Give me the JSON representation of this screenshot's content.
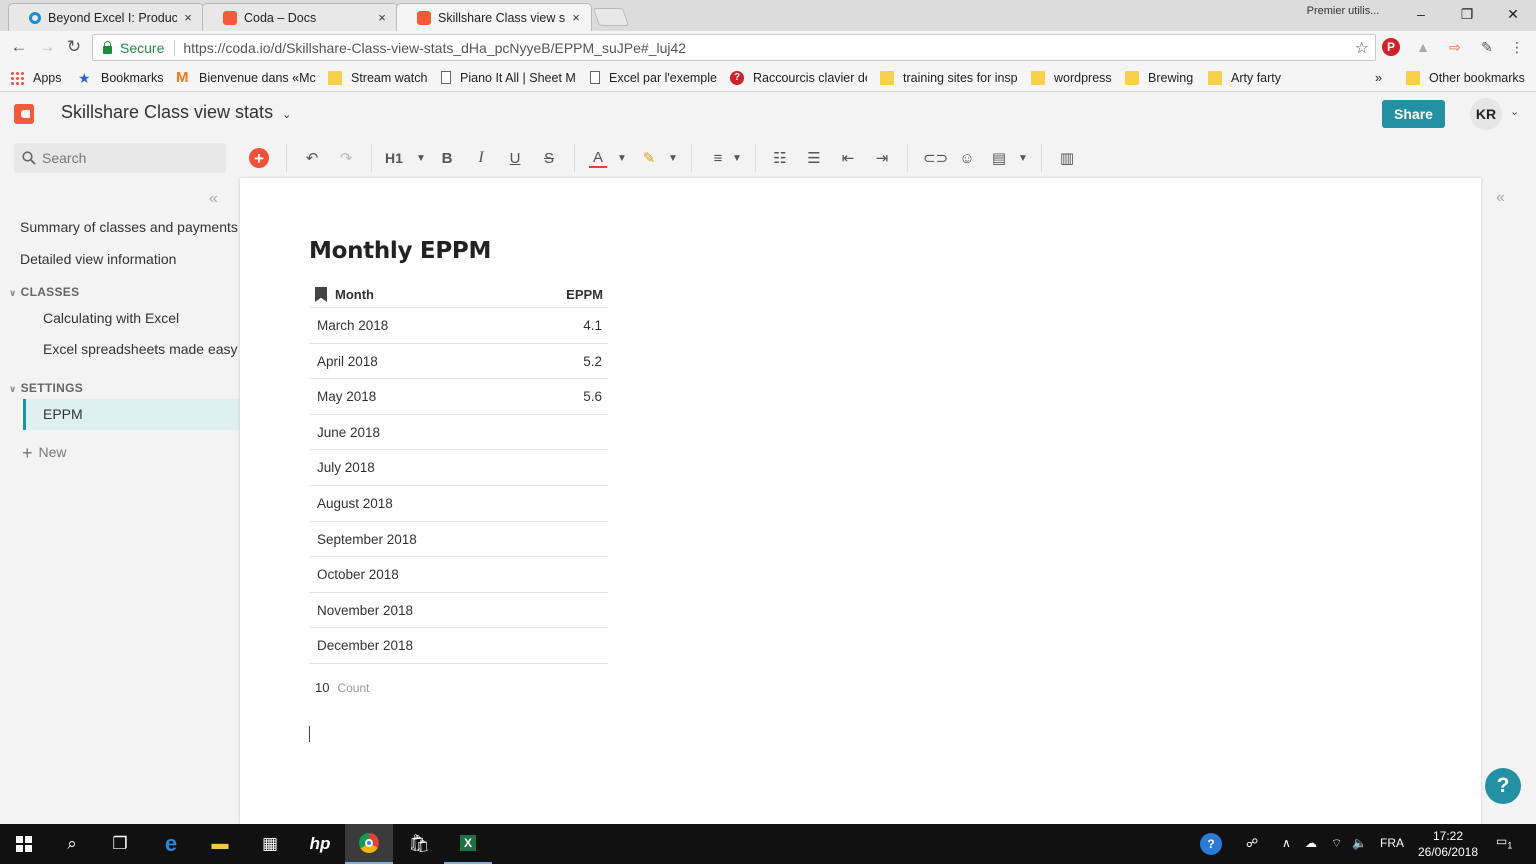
{
  "browser": {
    "tabs": [
      {
        "title": "Beyond Excel I: Productiv",
        "close": "×"
      },
      {
        "title": "Coda – Docs",
        "close": "×"
      },
      {
        "title": "Skillshare Class view stats",
        "close": "×"
      }
    ],
    "profile_label": "Premier utilis...",
    "window_controls": {
      "minimize": "–",
      "maximize": "❐",
      "close": "✕"
    },
    "omnibox": {
      "secure_label": "Secure",
      "url": "https://coda.io/d/Skillshare-Class-view-stats_dHa_pcNyyeB/EPPM_suJPe#_luj42"
    },
    "bookmarks": [
      {
        "label": "Apps"
      },
      {
        "label": "Bookmarks"
      },
      {
        "label": "Bienvenue dans «Mc"
      },
      {
        "label": "Stream watch"
      },
      {
        "label": "Piano It All | Sheet M"
      },
      {
        "label": "Excel par l'exemple"
      },
      {
        "label": "Raccourcis clavier de"
      },
      {
        "label": "training sites for insp"
      },
      {
        "label": "wordpress"
      },
      {
        "label": "Brewing"
      },
      {
        "label": "Arty farty"
      }
    ],
    "bookmarks_overflow": "»",
    "other_bookmarks": "Other bookmarks"
  },
  "coda": {
    "doc_title": "Skillshare Class view stats",
    "share_label": "Share",
    "avatar_initials": "KR",
    "search_placeholder": "Search",
    "toolbar": {
      "add": "+",
      "heading": "H1"
    }
  },
  "sidebar": {
    "top_items": [
      {
        "label": "Summary of classes and payments"
      },
      {
        "label": "Detailed view information"
      }
    ],
    "sections": [
      {
        "title": "CLASSES",
        "items": [
          "Calculating with Excel",
          "Excel spreadsheets made easy"
        ]
      },
      {
        "title": "SETTINGS",
        "items": [
          "EPPM"
        ]
      }
    ],
    "new_label": "New"
  },
  "page": {
    "heading": "Monthly EPPM",
    "table": {
      "columns": [
        "Month",
        "EPPM"
      ],
      "rows": [
        {
          "month": "March 2018",
          "eppm": "4.1"
        },
        {
          "month": "April 2018",
          "eppm": "5.2"
        },
        {
          "month": "May 2018",
          "eppm": "5.6"
        },
        {
          "month": "June 2018",
          "eppm": ""
        },
        {
          "month": "July 2018",
          "eppm": ""
        },
        {
          "month": "August 2018",
          "eppm": ""
        },
        {
          "month": "September 2018",
          "eppm": ""
        },
        {
          "month": "October 2018",
          "eppm": ""
        },
        {
          "month": "November 2018",
          "eppm": ""
        },
        {
          "month": "December 2018",
          "eppm": ""
        }
      ],
      "footer_count": "10",
      "footer_label": "Count"
    }
  },
  "help_label": "?",
  "taskbar": {
    "language": "FRA",
    "time": "17:22",
    "date": "26/06/2018",
    "notification_count": "1"
  },
  "colors": {
    "accent": "#2490a3",
    "coda_red": "#f35a3a",
    "add_button": "#f0503a"
  }
}
